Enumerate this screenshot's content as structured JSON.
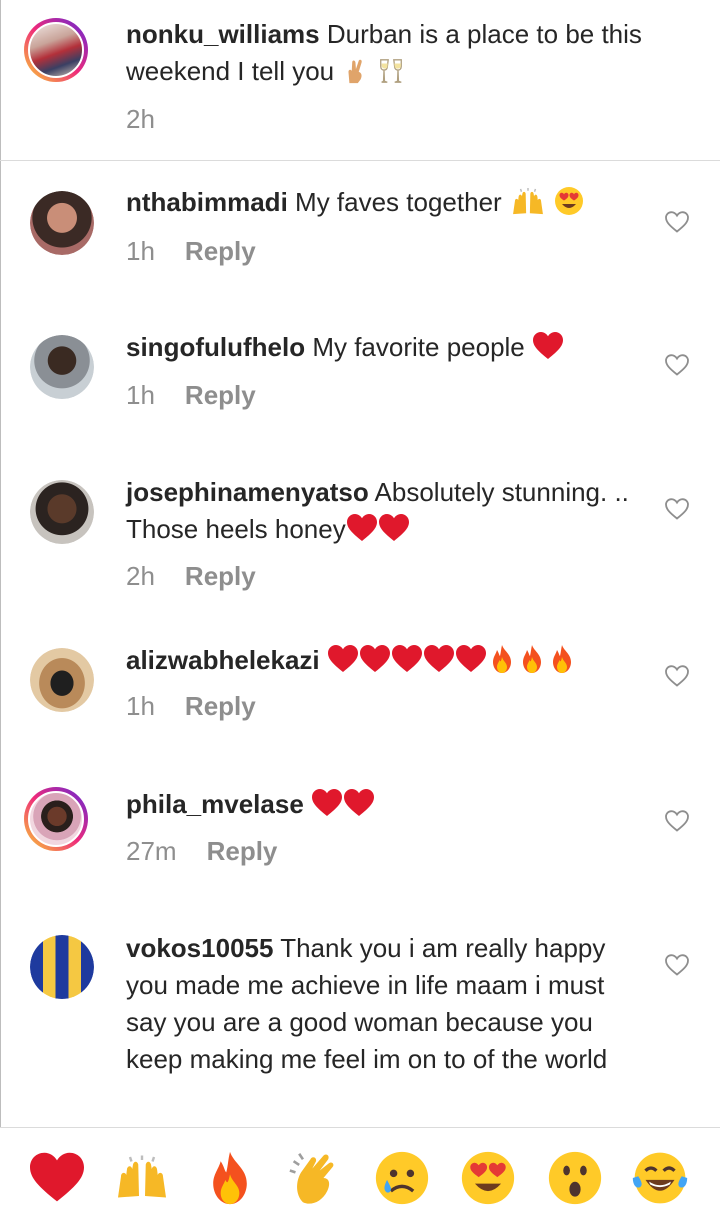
{
  "caption": {
    "username": "nonku_williams",
    "text": "Durban is a place to be this weekend I tell you",
    "emojis": [
      "crossed-fingers-icon",
      "clinking-glasses-icon"
    ],
    "time": "2h"
  },
  "comments": [
    {
      "username": "nthabimmadi",
      "text": "My faves together",
      "time": "1h",
      "reply": "Reply"
    },
    {
      "username": "singofulufhelo",
      "text": "My favorite people",
      "time": "1h",
      "reply": "Reply"
    },
    {
      "username": "josephinamenyatso",
      "text": "Absolutely stunning. .. Those heels honey",
      "time": "2h",
      "reply": "Reply"
    },
    {
      "username": "alizwabhelekazi",
      "text": "",
      "time": "1h",
      "reply": "Reply"
    },
    {
      "username": "phila_mvelase",
      "text": "",
      "time": "27m",
      "reply": "Reply"
    },
    {
      "username": "vokos10055",
      "text": "Thank you i am really happy you made me achieve in life maam i must say you are a good woman because you keep making me feel im on to of the world",
      "time": "",
      "reply": ""
    }
  ],
  "reaction_bar": [
    "red-heart-icon",
    "raising-hands-icon",
    "fire-icon",
    "clapping-hands-icon",
    "crying-face-icon",
    "heart-eyes-icon",
    "surprised-face-icon",
    "tears-of-joy-icon"
  ],
  "colors": {
    "accent_link": "#385185",
    "muted": "#8e8e8e",
    "heart_red": "#e0182c"
  }
}
